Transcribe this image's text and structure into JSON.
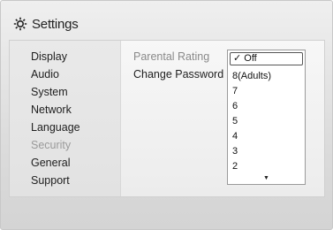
{
  "header": {
    "title": "Settings",
    "icon": "gear-icon"
  },
  "sidebar": {
    "items": [
      {
        "label": "Display"
      },
      {
        "label": "Audio"
      },
      {
        "label": "System"
      },
      {
        "label": "Network"
      },
      {
        "label": "Language"
      },
      {
        "label": "Security",
        "selected": true
      },
      {
        "label": "General"
      },
      {
        "label": "Support"
      }
    ]
  },
  "main": {
    "items": [
      {
        "label": "Parental Rating"
      },
      {
        "label": "Change Password"
      }
    ]
  },
  "dropdown": {
    "selected": "✓ Off",
    "options": [
      "8(Adults)",
      "7",
      "6",
      "5",
      "4",
      "3",
      "2"
    ],
    "more_indicator": "▼"
  }
}
